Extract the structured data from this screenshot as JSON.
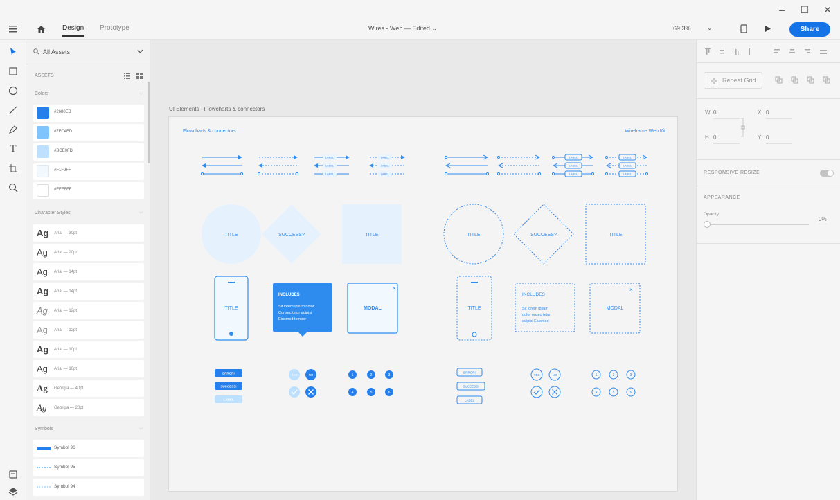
{
  "window": {
    "minimize": "–",
    "maximize": "☐",
    "close": "✕"
  },
  "topbar": {
    "menu_icon": "hamburger-icon",
    "home_icon": "home-icon",
    "tabs": [
      {
        "label": "Design"
      },
      {
        "label": "Prototype"
      }
    ],
    "doc_title": "Wires - Web — Edited ⌄",
    "zoom": "69.3%",
    "zoom_caret": "⌄",
    "share_label": "Share",
    "accent": "#1473e6"
  },
  "tools": [
    "select-icon",
    "rectangle-icon",
    "ellipse-icon",
    "line-icon",
    "pen-icon",
    "text-icon",
    "artboard-icon",
    "zoom-icon"
  ],
  "assets": {
    "filter_label": "All Assets",
    "assets_label": "ASSETS",
    "colors_label": "Colors",
    "colors": [
      {
        "name": "#2680EB",
        "hex": "#2680EB"
      },
      {
        "name": "#7FC4FD",
        "hex": "#7FC4FD"
      },
      {
        "name": "#BCE0FD",
        "hex": "#BCE0FD"
      },
      {
        "name": "#F1F9FF",
        "hex": "#F1F9FF"
      },
      {
        "name": "#FFFFFF",
        "hex": "#FFFFFF"
      }
    ],
    "char_label": "Character Styles",
    "char_styles": [
      {
        "ag": "Ag",
        "name": "Arial — 30pt"
      },
      {
        "ag": "Ag",
        "name": "Arial — 20pt"
      },
      {
        "ag": "Ag",
        "name": "Arial — 14pt"
      },
      {
        "ag": "Ag",
        "name": "Arial — 14pt"
      },
      {
        "ag": "Ag",
        "name": "Arial — 12pt"
      },
      {
        "ag": "Ag",
        "name": "Arial — 12pt"
      },
      {
        "ag": "Ag",
        "name": "Arial — 10pt"
      },
      {
        "ag": "Ag",
        "name": "Arial — 10pt"
      },
      {
        "ag": "Ag",
        "name": "Georgia — 40pt"
      },
      {
        "ag": "Ag",
        "name": "Georgia — 20pt"
      }
    ],
    "symbols_label": "Symbols",
    "symbols": [
      {
        "name": "Symbol 96"
      },
      {
        "name": "Symbol 95"
      },
      {
        "name": "Symbol 94"
      }
    ]
  },
  "canvas": {
    "artboard_name": "UI Elements - Flowcharts & connectors",
    "board_title": "Flowcharts & connectors",
    "kit_name": "Wireframe Web Kit",
    "connector_label": "LABEL",
    "title_text": "TITLE",
    "success_text": "SUCCESS?",
    "modal_text": "MODAL",
    "includes_text": "INCLUDES",
    "tip_lines": [
      "Sit lorem ipsum dolor",
      "Consec tetur adipisi",
      "Eiusmod tempor"
    ],
    "tip_lines_outline": [
      "Sit lorem ipsum",
      "dolor onsec tetur",
      "adipisi Eiusmod"
    ],
    "error_text": "ERROR!",
    "success_btn": "SUCCESS!",
    "label_btn": "LABEL",
    "yes": "YES",
    "no": "NO",
    "numbers": [
      "1",
      "2",
      "3",
      "4",
      "5",
      "6"
    ],
    "modal_close": "×"
  },
  "props": {
    "repeat_grid": "Repeat Grid",
    "w_label": "W",
    "w_value": "0",
    "x_label": "X",
    "x_value": "0",
    "h_label": "H",
    "h_value": "0",
    "y_label": "Y",
    "y_value": "0",
    "responsive_label": "RESPONSIVE RESIZE",
    "appearance_label": "APPEARANCE",
    "opacity_label": "Opacity",
    "opacity_value": "0%"
  },
  "bottom_icons": [
    "library-icon",
    "layers-icon"
  ]
}
